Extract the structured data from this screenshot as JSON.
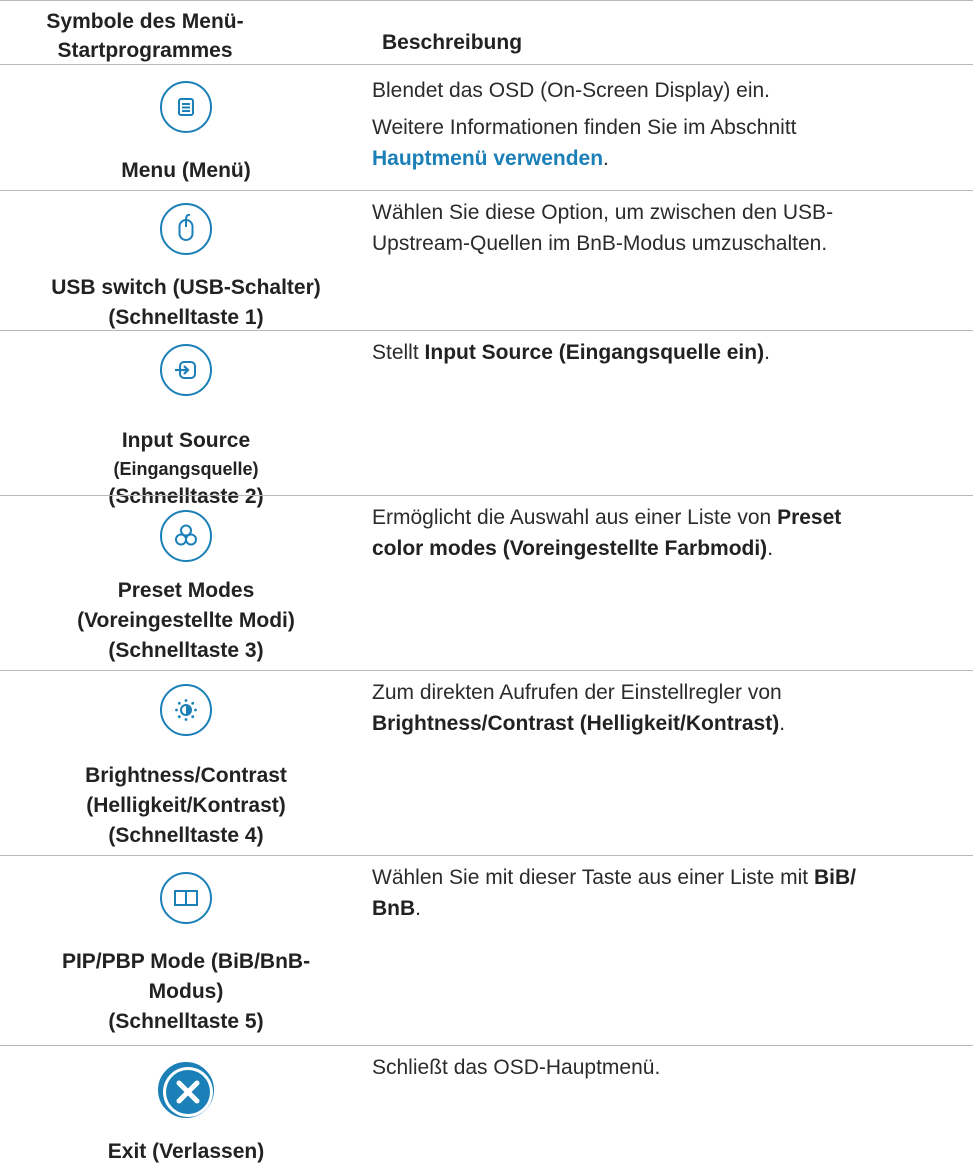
{
  "header": {
    "col1_line1": "Symbole des Menü-",
    "col1_line2": "Startprogrammes",
    "col2": "Beschreibung"
  },
  "rows": [
    {
      "icon": "menu-list-icon",
      "label_lines": [
        "Menu (Menü)"
      ],
      "desc1": "Blendet das OSD (On-Screen Display) ein.",
      "desc2_prefix": "Weitere Informationen finden Sie im Abschnitt",
      "desc2_link": "Hauptmenü verwenden",
      "desc2_suffix": "."
    },
    {
      "icon": "mouse-icon",
      "label_lines": [
        "USB switch (USB-Schalter)",
        "(Schnelltaste 1)"
      ],
      "desc_line1": "Wählen Sie diese Option, um zwischen den USB-",
      "desc_line2": "Upstream-Quellen im BnB-Modus umzuschalten."
    },
    {
      "icon": "input-source-icon",
      "label_lines": [
        "Input Source",
        "(Eingangsquelle)",
        "(Schnelltaste 2)"
      ],
      "desc_prefix": "Stellt ",
      "desc_bold": "Input Source (Eingangsquelle ein)",
      "desc_suffix": "."
    },
    {
      "icon": "preset-modes-icon",
      "label_lines": [
        "Preset Modes",
        "(Voreingestellte Modi)",
        "(Schnelltaste 3)"
      ],
      "desc_prefix": "Ermöglicht die Auswahl aus einer Liste von ",
      "desc_bold1": "Preset",
      "desc_bold2": "color modes (Voreingestellte Farbmodi)",
      "desc_suffix": "."
    },
    {
      "icon": "brightness-contrast-icon",
      "label_lines": [
        "Brightness/Contrast",
        "(Helligkeit/Kontrast)",
        "(Schnelltaste 4)"
      ],
      "desc_line1": "Zum direkten Aufrufen der Einstellregler von",
      "desc_bold": "Brightness/Contrast (Helligkeit/Kontrast)",
      "desc_suffix": "."
    },
    {
      "icon": "pip-pbp-icon",
      "label_lines": [
        "PIP/PBP Mode (BiB/BnB-",
        "Modus)",
        "(Schnelltaste 5)"
      ],
      "desc_prefix": "Wählen Sie mit dieser Taste aus einer Liste mit ",
      "desc_bold1": "BiB/",
      "desc_bold2": "BnB",
      "desc_suffix": "."
    },
    {
      "icon": "exit-close-icon",
      "label_lines": [
        "Exit (Verlassen)"
      ],
      "desc": "Schließt das OSD-Hauptmenü."
    }
  ],
  "colors": {
    "accent": "#1b7fb8",
    "border": "#b8b8b8",
    "text": "#222222"
  }
}
